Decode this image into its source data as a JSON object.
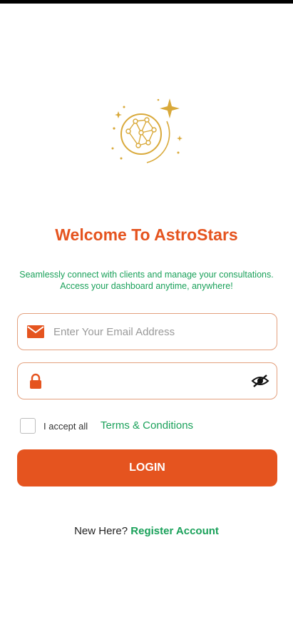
{
  "app": {
    "title": "Welcome To AstroStars",
    "subtitle": "Seamlessly connect with clients and manage your consultations. Access your dashboard anytime, anywhere!"
  },
  "colors": {
    "accent": "#e5541f",
    "link": "#1aa15a",
    "field_border": "#e3a07e",
    "logo_gold": "#d9a93a"
  },
  "logo": {
    "icon": "constellation-globe-icon"
  },
  "form": {
    "email": {
      "icon": "envelope-icon",
      "placeholder": "Enter Your Email Address",
      "value": ""
    },
    "password": {
      "icon": "lock-icon",
      "value": "",
      "visibility_icon": "eye-slash-icon"
    },
    "terms": {
      "checked": false,
      "prefix": "I accept all",
      "link": "Terms & Conditions"
    },
    "login_label": "LOGIN"
  },
  "register": {
    "question": "New Here?",
    "link": "Register Account"
  }
}
